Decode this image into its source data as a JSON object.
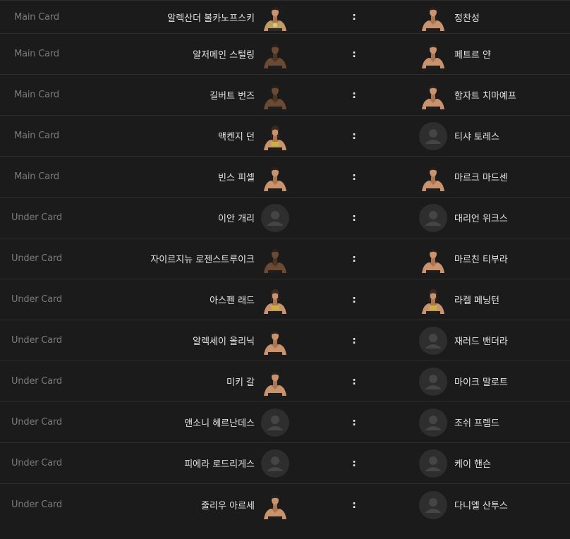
{
  "vs_separator": ":",
  "fights": [
    {
      "card": "Main Card",
      "left": {
        "name": "알렉산더 볼카노프스키",
        "photo": true,
        "belt": true
      },
      "right": {
        "name": "정찬성",
        "photo": true
      }
    },
    {
      "card": "Main Card",
      "left": {
        "name": "알저메인 스털링",
        "photo": true,
        "dark": true
      },
      "right": {
        "name": "페트르 얀",
        "photo": true
      }
    },
    {
      "card": "Main Card",
      "left": {
        "name": "길버트 번즈",
        "photo": true,
        "dark": true
      },
      "right": {
        "name": "함자트 치마예프",
        "photo": true
      }
    },
    {
      "card": "Main Card",
      "left": {
        "name": "맥켄지 던",
        "photo": true,
        "female": true
      },
      "right": {
        "name": "티샤 토레스",
        "photo": false
      }
    },
    {
      "card": "Main Card",
      "left": {
        "name": "빈스 피셀",
        "photo": true
      },
      "right": {
        "name": "마르크 마드센",
        "photo": true
      }
    },
    {
      "card": "Under Card",
      "left": {
        "name": "이안 개리",
        "photo": false
      },
      "right": {
        "name": "대리언 위크스",
        "photo": false
      }
    },
    {
      "card": "Under Card",
      "left": {
        "name": "자이르지뉴 로젠스트루이크",
        "photo": true,
        "dark": true
      },
      "right": {
        "name": "마르친 티부라",
        "photo": true
      }
    },
    {
      "card": "Under Card",
      "left": {
        "name": "아스펜 래드",
        "photo": true,
        "female": true
      },
      "right": {
        "name": "라켈 페닝턴",
        "photo": true,
        "female": true
      }
    },
    {
      "card": "Under Card",
      "left": {
        "name": "알렉세이 올리닉",
        "photo": true
      },
      "right": {
        "name": "재러드 밴더라",
        "photo": false
      }
    },
    {
      "card": "Under Card",
      "left": {
        "name": "미키 갈",
        "photo": true
      },
      "right": {
        "name": "마이크 말로트",
        "photo": false
      }
    },
    {
      "card": "Under Card",
      "left": {
        "name": "앤소니 헤르난데스",
        "photo": false
      },
      "right": {
        "name": "조쉬 프렘드",
        "photo": false
      }
    },
    {
      "card": "Under Card",
      "left": {
        "name": "피에라 로드리게스",
        "photo": false
      },
      "right": {
        "name": "케이 핸슨",
        "photo": false
      }
    },
    {
      "card": "Under Card",
      "left": {
        "name": "줄리우 아르세",
        "photo": true
      },
      "right": {
        "name": "다니엘 산투스",
        "photo": false
      }
    }
  ],
  "colors": {
    "background": "#1b1b1b",
    "row_border": "#2d2d2d",
    "card_label": "#7a7a7a",
    "name": "#e4e4e4",
    "placeholder_bg": "#2e2e2e",
    "placeholder_fg": "#454545"
  },
  "icons": {
    "placeholder": "person-silhouette-icon",
    "photo": "fighter-photo"
  }
}
